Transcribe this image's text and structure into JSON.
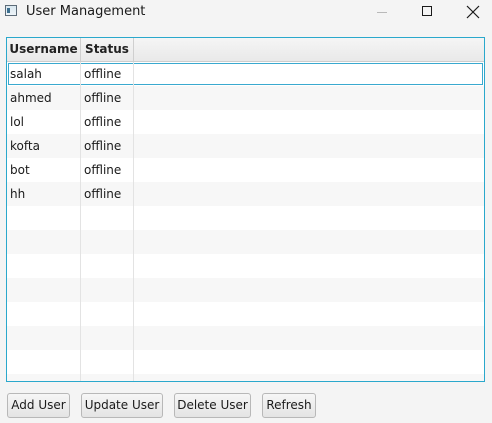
{
  "window": {
    "title": "User Management"
  },
  "table": {
    "columns": [
      "Username",
      "Status"
    ],
    "rows": [
      {
        "username": "salah",
        "status": "offline"
      },
      {
        "username": "ahmed",
        "status": "offline"
      },
      {
        "username": "lol",
        "status": "offline"
      },
      {
        "username": "kofta",
        "status": "offline"
      },
      {
        "username": "bot",
        "status": "offline"
      },
      {
        "username": "hh",
        "status": "offline"
      }
    ],
    "selected_row_index": 0
  },
  "buttons": {
    "add": "Add User",
    "update": "Update User",
    "delete": "Delete User",
    "refresh": "Refresh"
  },
  "icons": {
    "app": "window-icon",
    "minimize": "minimize-icon",
    "maximize": "maximize-icon",
    "close": "close-icon"
  },
  "colors": {
    "focus_border": "#2aa8cc",
    "background": "#f4f4f4"
  }
}
